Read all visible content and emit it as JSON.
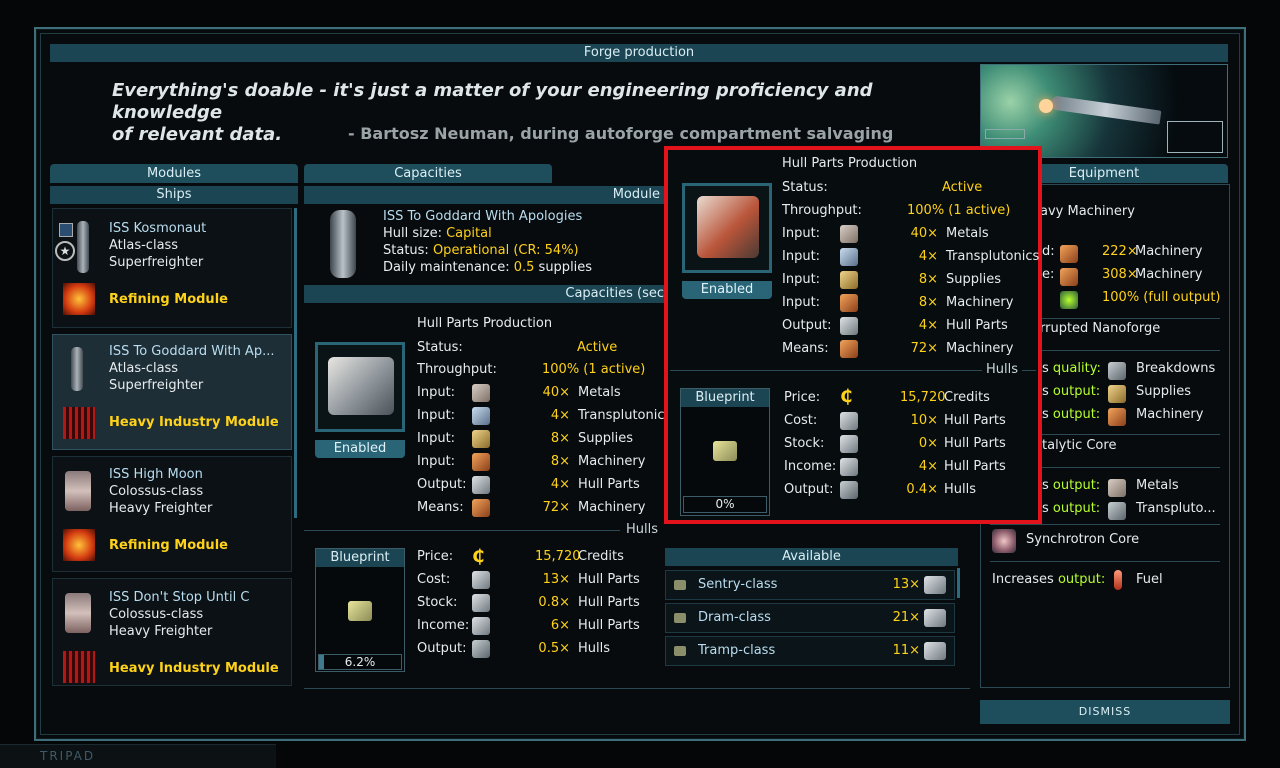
{
  "window_title": "Forge production",
  "quote": {
    "text": "Everything's doable - it's just a matter of your engineering proficiency and knowledge of relevant data.",
    "line1": "Everything's doable - it's just a matter of your engineering proficiency and knowledge",
    "line2": "of relevant data.",
    "author": "- Bartosz Neuman, during autoforge compartment salvaging"
  },
  "tabs": {
    "modules": "Modules",
    "capacities": "Capacities",
    "equipment": "Equipment"
  },
  "ships_header": "Ships",
  "module_header": "Module",
  "capacities_section_header": "Capacities (sec",
  "ships": [
    {
      "name": "ISS Kosmonaut",
      "class": "Atlas-class",
      "type": "Superfreighter",
      "module": "Refining Module",
      "selected": false
    },
    {
      "name": "ISS To Goddard With Ap...",
      "class": "Atlas-class",
      "type": "Superfreighter",
      "module": "Heavy Industry Module",
      "selected": true
    },
    {
      "name": "ISS High Moon",
      "class": "Colossus-class",
      "type": "Heavy Freighter",
      "module": "Refining Module",
      "selected": false
    },
    {
      "name": "ISS Don't Stop Until C",
      "class": "Colossus-class",
      "type": "Heavy Freighter",
      "module": "Heavy Industry Module",
      "selected": false
    }
  ],
  "selected_ship": {
    "name": "ISS To Goddard With Apologies",
    "hull_size_label": "Hull size:",
    "hull_size": "Capital",
    "status_label": "Status:",
    "status": "Operational (CR: 54%)",
    "maintenance_label": "Daily maintenance:",
    "maintenance_value": "0.5",
    "maintenance_unit": "supplies"
  },
  "production": {
    "title": "Hull Parts Production",
    "enabled": "Enabled",
    "status_label": "Status:",
    "status": "Active",
    "throughput_label": "Throughput:",
    "throughput": "100% (1 active)",
    "rows": [
      {
        "label": "Input:",
        "qty": "40×",
        "item": "Metals"
      },
      {
        "label": "Input:",
        "qty": "4×",
        "item": "Transplutonics"
      },
      {
        "label": "Input:",
        "qty": "8×",
        "item": "Supplies"
      },
      {
        "label": "Input:",
        "qty": "8×",
        "item": "Machinery"
      },
      {
        "label": "Output:",
        "qty": "4×",
        "item": "Hull Parts"
      },
      {
        "label": "Means:",
        "qty": "72×",
        "item": "Machinery"
      }
    ]
  },
  "hulls_section": {
    "title": "Hulls",
    "blueprint": "Blueprint",
    "progress": "6.2%",
    "progress_fraction": 0.062,
    "price_label": "Price:",
    "price": "15,720",
    "price_unit": "Credits",
    "rows": [
      {
        "label": "Cost:",
        "qty": "13×",
        "item": "Hull Parts"
      },
      {
        "label": "Stock:",
        "qty": "0.8×",
        "item": "Hull Parts"
      },
      {
        "label": "Income:",
        "qty": "6×",
        "item": "Hull Parts"
      },
      {
        "label": "Output:",
        "qty": "0.5×",
        "item": "Hulls"
      }
    ]
  },
  "available": {
    "title": "Available",
    "items": [
      {
        "name": "Sentry-class",
        "qty": "13×"
      },
      {
        "name": "Dram-class",
        "qty": "21×"
      },
      {
        "name": "Tramp-class",
        "qty": "11×"
      }
    ]
  },
  "equipment": {
    "heavy_machinery": "avy Machinery",
    "hm_rows": [
      {
        "prefix": "d:",
        "value": "222×",
        "item": "Machinery"
      },
      {
        "prefix": "e:",
        "value": "308×",
        "item": "Machinery"
      },
      {
        "prefix": "",
        "value": "100% (full output)",
        "item": ""
      }
    ],
    "nanoforge": "rrupted Nanoforge",
    "nf_rows": [
      {
        "pre": "s",
        "kw": "quality:",
        "item": "Breakdowns"
      },
      {
        "pre": "s",
        "kw": "output:",
        "item": "Supplies"
      },
      {
        "pre": "s",
        "kw": "output:",
        "item": "Machinery"
      }
    ],
    "catalytic": "talytic Core",
    "cc_rows": [
      {
        "pre": "s",
        "kw": "output:",
        "item": "Metals"
      },
      {
        "pre": "s",
        "kw": "output:",
        "item": "Transpluto..."
      }
    ],
    "synchrotron": "Synchrotron Core",
    "increases": "Increases",
    "increases_kw": "output:",
    "increases_item": "Fuel"
  },
  "popup": {
    "title": "Hull Parts Production",
    "enabled": "Enabled",
    "status_label": "Status:",
    "status": "Active",
    "throughput_label": "Throughput:",
    "throughput": "100% (1 active)",
    "rows": [
      {
        "label": "Input:",
        "qty": "40×",
        "item": "Metals"
      },
      {
        "label": "Input:",
        "qty": "4×",
        "item": "Transplutonics"
      },
      {
        "label": "Input:",
        "qty": "8×",
        "item": "Supplies"
      },
      {
        "label": "Input:",
        "qty": "8×",
        "item": "Machinery"
      },
      {
        "label": "Output:",
        "qty": "4×",
        "item": "Hull Parts"
      },
      {
        "label": "Means:",
        "qty": "72×",
        "item": "Machinery"
      }
    ],
    "hulls_title": "Hulls",
    "blueprint": "Blueprint",
    "progress": "0%",
    "progress_fraction": 0,
    "price_label": "Price:",
    "price": "15,720",
    "price_unit": "Credits",
    "hull_rows": [
      {
        "label": "Cost:",
        "qty": "10×",
        "item": "Hull Parts"
      },
      {
        "label": "Stock:",
        "qty": "0×",
        "item": "Hull Parts"
      },
      {
        "label": "Income:",
        "qty": "4×",
        "item": "Hull Parts"
      },
      {
        "label": "Output:",
        "qty": "0.4×",
        "item": "Hulls"
      }
    ]
  },
  "dismiss": "DISMISS",
  "bottom_tab": "TRIPAD"
}
